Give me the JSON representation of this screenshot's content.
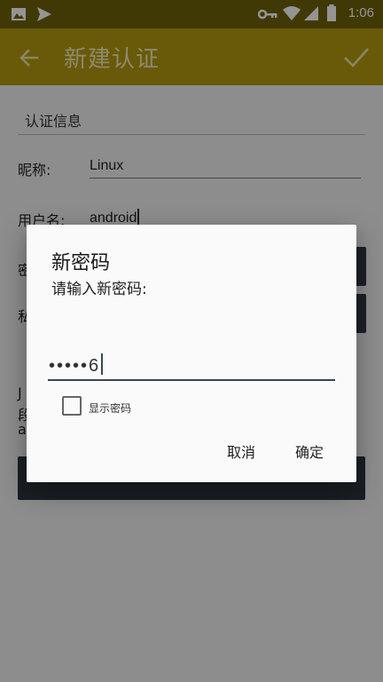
{
  "status_bar": {
    "time": "1:06",
    "icons": [
      "image-icon",
      "send-icon",
      "key-icon",
      "wifi-icon",
      "signal-icon",
      "battery-icon"
    ]
  },
  "toolbar": {
    "title": "新建认证",
    "back_icon": "arrow-back-icon",
    "confirm_icon": "check-icon",
    "bg_color": "#b39b10"
  },
  "form": {
    "section_title": "认证信息",
    "nickname_label": "昵称:",
    "nickname_value": "Linux",
    "username_label": "用户名:",
    "username_value": "android",
    "password_label_partial": "密",
    "private_key_label_partial": "私",
    "note_line1_partial": "J",
    "note_line2_partial": "段",
    "note_line3_partial": "a"
  },
  "dialog": {
    "title": "新密码",
    "message": "请输入新密码:",
    "password_value": "•••••6",
    "show_password_label": "显示密码",
    "show_password_checked": false,
    "cancel_label": "取消",
    "ok_label": "确定"
  }
}
